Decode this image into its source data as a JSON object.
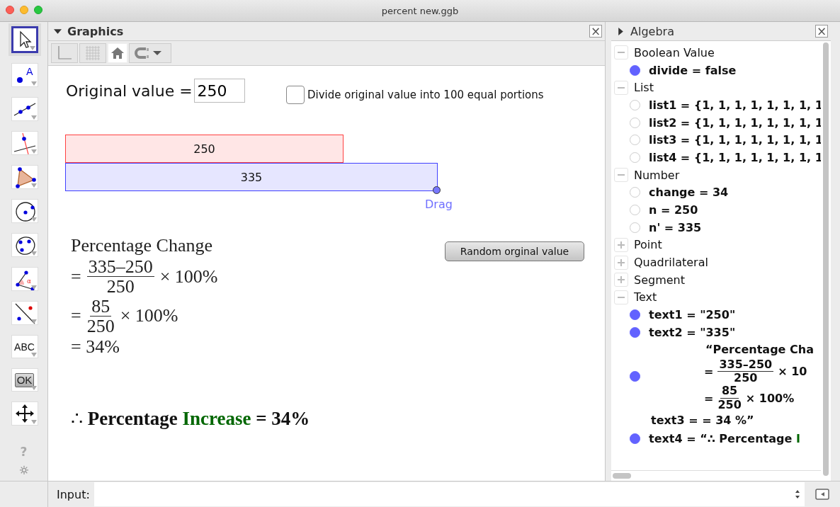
{
  "window": {
    "title": "percent new.ggb"
  },
  "tools": [
    {
      "kind": "move",
      "selected": true
    },
    {
      "kind": "point",
      "label": "A",
      "selected": false
    },
    {
      "kind": "line",
      "selected": false
    },
    {
      "kind": "perpendicular",
      "selected": false
    },
    {
      "kind": "polygon",
      "selected": false
    },
    {
      "kind": "circle",
      "selected": false
    },
    {
      "kind": "conic",
      "selected": false
    },
    {
      "kind": "angle",
      "label": "α",
      "selected": false
    },
    {
      "kind": "reflect",
      "selected": false
    },
    {
      "kind": "text",
      "label": "ABC",
      "selected": false
    },
    {
      "kind": "button",
      "label": "OK",
      "selected": false
    },
    {
      "kind": "pan",
      "selected": false
    }
  ],
  "help": "?",
  "graphics": {
    "title": "Graphics",
    "close": "×",
    "input": {
      "label": "Original value =",
      "value": "250"
    },
    "checkbox": {
      "label": "Divide original value into 100 equal portions",
      "checked": false
    },
    "bars": [
      {
        "text": "250",
        "color": "#ff4040"
      },
      {
        "text": "335",
        "color": "#4040ff"
      }
    ],
    "drag_label": "Drag",
    "button": "Random orginal value",
    "formula": [
      {
        "kind": "text",
        "text": "Percentage Change"
      },
      {
        "kind": "fraction",
        "prefix": "=",
        "numerator": "335–250",
        "denominator": "250",
        "suffix": "× 100%"
      },
      {
        "kind": "fraction",
        "prefix": "=",
        "numerator": "85",
        "denominator": "250",
        "suffix": "× 100%"
      },
      {
        "kind": "text",
        "text": "= 34%"
      }
    ],
    "conclusion": {
      "therefore": "∴",
      "before": "Percentage",
      "highlight": "Increase",
      "after": "= 34%"
    }
  },
  "algebra": {
    "title": "Algebra",
    "close": "×",
    "groups": [
      {
        "name": "Boolean Value",
        "expanded": true,
        "items": [
          {
            "kind": "plain",
            "shown": true,
            "text": "divide = false"
          }
        ]
      },
      {
        "name": "List",
        "expanded": true,
        "items": [
          {
            "kind": "plain",
            "shown": false,
            "text": "list1 = {1, 1, 1, 1, 1, 1, 1, 1"
          },
          {
            "kind": "plain",
            "shown": false,
            "text": "list2 = {1, 1, 1, 1, 1, 1, 1, 1"
          },
          {
            "kind": "plain",
            "shown": false,
            "text": "list3 = {1, 1, 1, 1, 1, 1, 1, 1"
          },
          {
            "kind": "plain",
            "shown": false,
            "text": "list4 = {1, 1, 1, 1, 1, 1, 1, 1"
          }
        ]
      },
      {
        "name": "Number",
        "expanded": true,
        "items": [
          {
            "kind": "plain",
            "shown": false,
            "text": "change = 34"
          },
          {
            "kind": "plain",
            "shown": false,
            "text": "n = 250"
          },
          {
            "kind": "plain",
            "shown": false,
            "text": "n' = 335"
          }
        ]
      },
      {
        "name": "Point",
        "expanded": false
      },
      {
        "name": "Quadrilateral",
        "expanded": false
      },
      {
        "name": "Segment",
        "expanded": false
      },
      {
        "name": "Text",
        "expanded": true,
        "items": [
          {
            "kind": "plain",
            "shown": true,
            "text": "text1 = \"250\""
          },
          {
            "kind": "plain",
            "shown": true,
            "text": "text2 = \"335\""
          },
          {
            "kind": "formula",
            "shown": true,
            "head": "“Percentage Cha",
            "lines": [
              {
                "prefix": "=",
                "numerator": "335–250",
                "denominator": "250",
                "suffix": "× 10"
              },
              {
                "prefix": "=",
                "numerator": "85",
                "denominator": "250",
                "suffix": "× 100%"
              }
            ],
            "tail": "text3 = =  34 %”"
          },
          {
            "kind": "plain",
            "shown": true,
            "text": "text4 = “∴ Percentage",
            "highlight": "I"
          }
        ]
      }
    ]
  },
  "input_bar": {
    "label": "Input:"
  }
}
